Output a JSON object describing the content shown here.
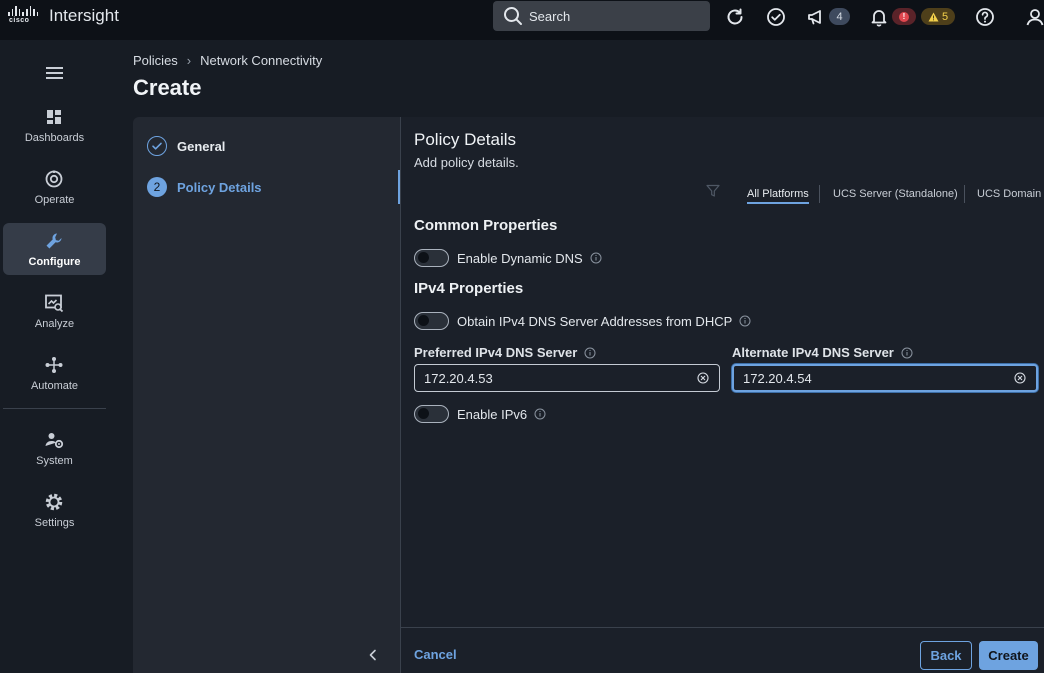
{
  "app": {
    "brand_logo_text": "cisco",
    "name": "Intersight"
  },
  "topbar": {
    "search_placeholder": "Search",
    "announcements_count": "4",
    "critical_alarm_glyph": "!",
    "warning_count": "5",
    "icons": [
      "refresh-icon",
      "task-check-icon",
      "megaphone-icon",
      "bell-icon",
      "help-icon",
      "user-icon"
    ],
    "colors": {
      "critical": "#e0474f",
      "warning": "#f2d04b"
    }
  },
  "nav": {
    "items": [
      {
        "label": "Dashboards",
        "icon": "dashboard-icon"
      },
      {
        "label": "Operate",
        "icon": "operate-icon"
      },
      {
        "label": "Configure",
        "icon": "wrench-icon",
        "active": true
      },
      {
        "label": "Analyze",
        "icon": "analyze-icon"
      },
      {
        "label": "Automate",
        "icon": "workflow-icon"
      },
      {
        "label": "System",
        "icon": "system-user-gear-icon"
      },
      {
        "label": "Settings",
        "icon": "gear-icon"
      }
    ]
  },
  "breadcrumb": {
    "items": [
      "Policies",
      "Network Connectivity"
    ]
  },
  "page": {
    "title": "Create"
  },
  "steps": [
    {
      "label": "General",
      "state": "done"
    },
    {
      "number": "2",
      "label": "Policy Details",
      "state": "active"
    }
  ],
  "details": {
    "title": "Policy Details",
    "subtitle": "Add policy details.",
    "platform_tabs": [
      "All Platforms",
      "UCS Server (Standalone)",
      "UCS Domain"
    ],
    "selected_platform": "All Platforms",
    "common_title": "Common Properties",
    "enable_dynamic_dns": {
      "label": "Enable Dynamic DNS",
      "on": false
    },
    "ipv4_title": "IPv4 Properties",
    "obtain_from_dhcp": {
      "label": "Obtain IPv4 DNS Server Addresses from DHCP",
      "on": false
    },
    "preferred_dns": {
      "label": "Preferred IPv4 DNS Server",
      "value": "172.20.4.53"
    },
    "alternate_dns": {
      "label": "Alternate IPv4 DNS Server",
      "value": "172.20.4.54"
    },
    "enable_ipv6": {
      "label": "Enable IPv6",
      "on": false
    }
  },
  "footer": {
    "cancel": "Cancel",
    "back": "Back",
    "create": "Create"
  },
  "accent_color": "#6ea3e0"
}
